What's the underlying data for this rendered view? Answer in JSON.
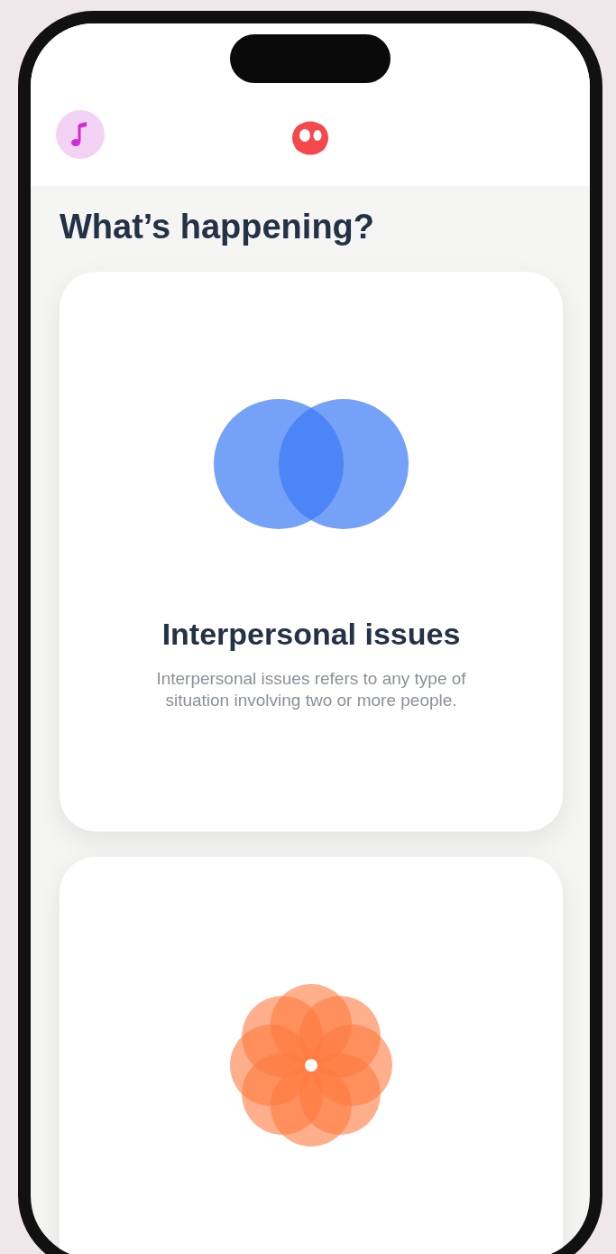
{
  "title": "What’s happening?",
  "cards": [
    {
      "kind": "venn",
      "title": "Interpersonal issues",
      "description": "Interpersonal issues refers to any type of situation involving two or more people."
    },
    {
      "kind": "flower"
    }
  ]
}
